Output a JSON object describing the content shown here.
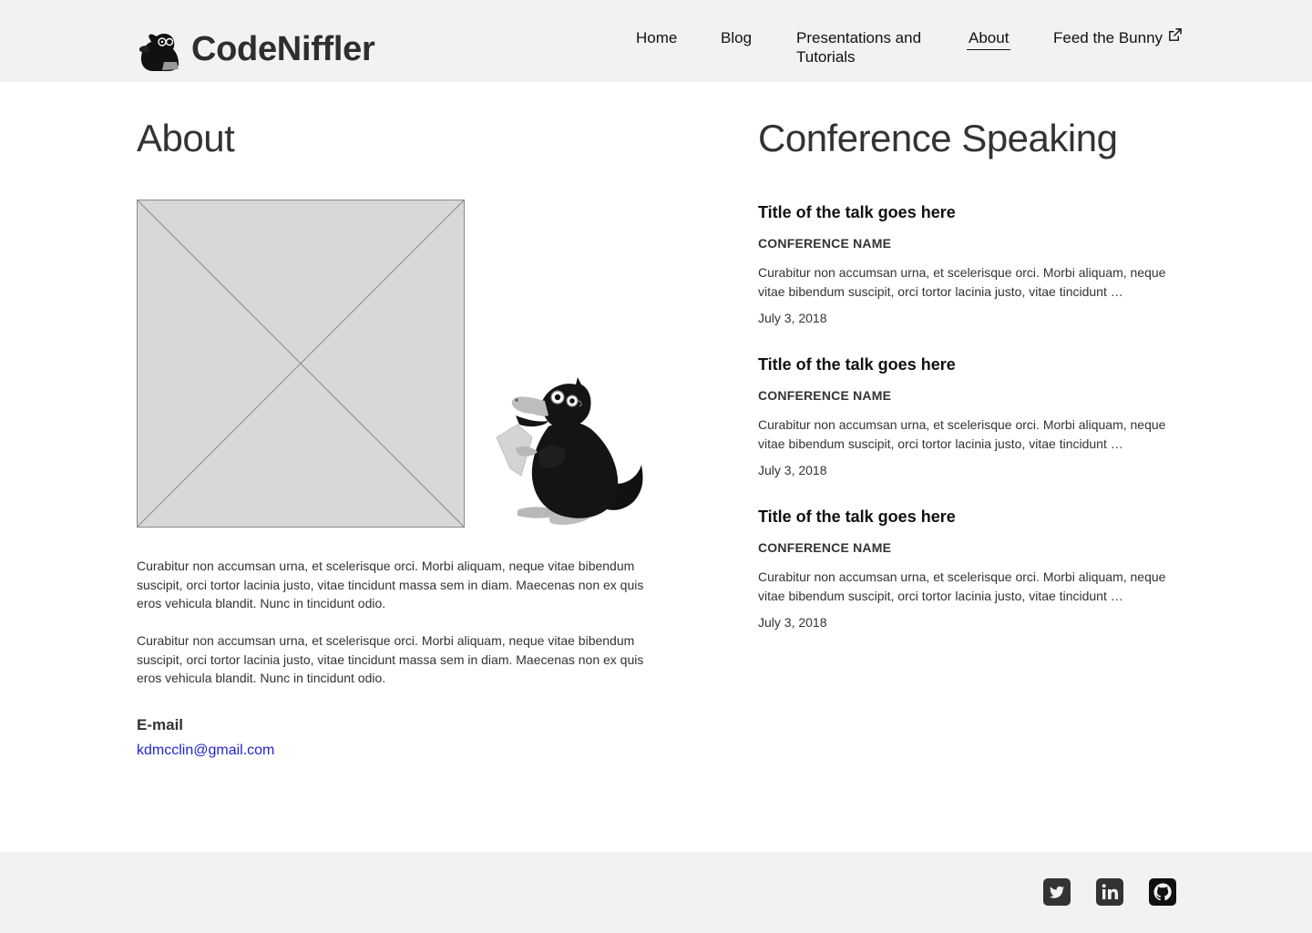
{
  "header": {
    "brand_name": "CodeNiffler",
    "nav": [
      {
        "label": "Home"
      },
      {
        "label": "Blog"
      },
      {
        "label": "Presentations and Tutorials"
      },
      {
        "label": "About",
        "active": true
      },
      {
        "label": "Feed the Bunny",
        "external": true
      }
    ]
  },
  "about": {
    "title": "About",
    "paragraphs": [
      "Curabitur non accumsan urna, et scelerisque orci. Morbi aliquam, neque vitae bibendum suscipit, orci tortor lacinia justo, vitae tincidunt massa sem in diam. Maecenas non ex quis eros vehicula blandit. Nunc in tincidunt odio.",
      "Curabitur non accumsan urna, et scelerisque orci. Morbi aliquam, neque vitae bibendum suscipit, orci tortor lacinia justo, vitae tincidunt massa sem in diam. Maecenas non ex quis eros vehicula blandit. Nunc in tincidunt odio."
    ],
    "email_label": "E-mail",
    "email": "kdmcclin@gmail.com"
  },
  "speaking": {
    "title": "Conference Speaking",
    "talks": [
      {
        "title": "Title of the talk goes here",
        "conference": "CONFERENCE NAME",
        "description": "Curabitur non accumsan urna, et scelerisque orci. Morbi aliquam, neque vitae bibendum suscipit, orci tortor lacinia justo, vitae tincidunt …",
        "date": "July 3, 2018"
      },
      {
        "title": "Title of the talk goes here",
        "conference": "CONFERENCE NAME",
        "description": "Curabitur non accumsan urna, et scelerisque orci. Morbi aliquam, neque vitae bibendum suscipit, orci tortor lacinia justo, vitae tincidunt …",
        "date": "July 3, 2018"
      },
      {
        "title": "Title of the talk goes here",
        "conference": "CONFERENCE NAME",
        "description": "Curabitur non accumsan urna, et scelerisque orci. Morbi aliquam, neque vitae bibendum suscipit, orci tortor lacinia justo, vitae tincidunt …",
        "date": "July 3, 2018"
      }
    ]
  },
  "footer": {
    "social": [
      {
        "icon": "twitter-icon"
      },
      {
        "icon": "linkedin-icon"
      },
      {
        "icon": "github-icon"
      }
    ]
  },
  "colors": {
    "header_bg": "#f2f2f2",
    "footer_bg": "#f2f2f2",
    "link": "#2323d0",
    "text": "#333333",
    "placeholder_fill": "#d8d8d8"
  }
}
